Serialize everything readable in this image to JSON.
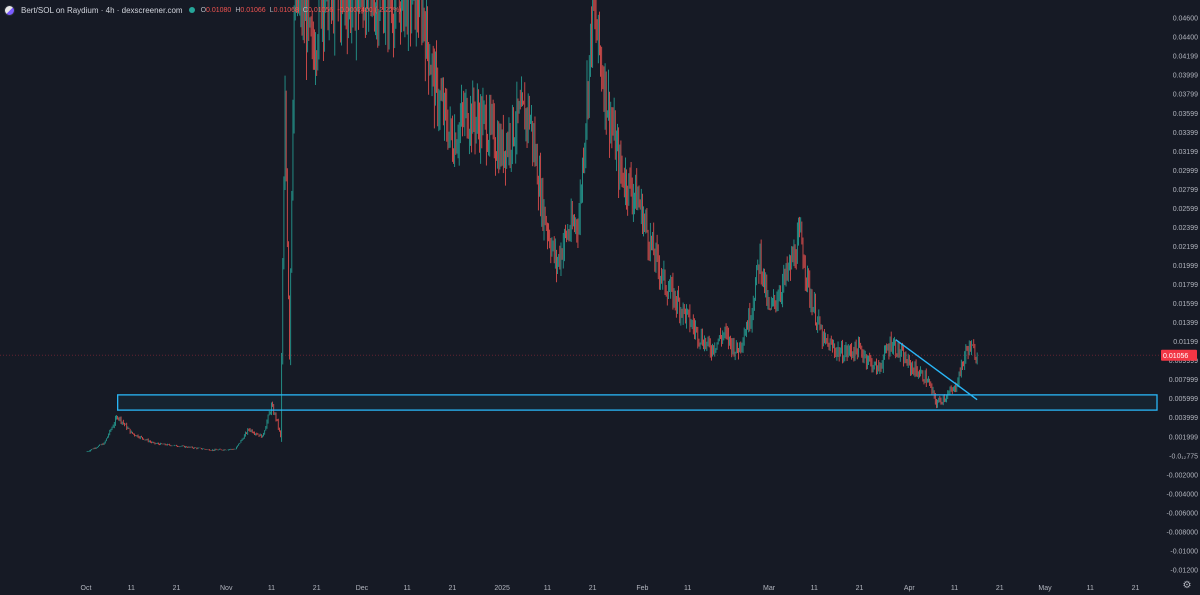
{
  "legend": {
    "title": "Bert/SOL on Raydium · 4h · dexscreener.com",
    "o_label": "O",
    "o_value": "0.01080",
    "h_label": "H",
    "h_value": "0.01066",
    "l_label": "L",
    "l_value": "0.01068",
    "c_label": "C",
    "c_value": "0.01056",
    "change": "-0.0002400 (-2.22%)"
  },
  "icons": {
    "pair": "bert-sol-pair-icon",
    "status": "live-dot-icon",
    "settings": "settings-gear-icon"
  },
  "colors": {
    "background": "#161a25",
    "up": "#26a69a",
    "down": "#ef5350",
    "drawing": "#29b6f6",
    "price_label": "#f23645"
  },
  "chart_data": {
    "type": "candlestick",
    "y_axis": {
      "min": -0.0125,
      "max": 0.0475,
      "ticks": [
        "0.04600",
        "0.04400",
        "0.04199",
        "0.03999",
        "0.03799",
        "0.03599",
        "0.03399",
        "0.03199",
        "0.02999",
        "0.02799",
        "0.02599",
        "0.02399",
        "0.02199",
        "0.01999",
        "0.01799",
        "0.01599",
        "0.01399",
        "0.01199",
        "0.009999",
        "0.007999",
        "0.005999",
        "0.003999",
        "0.001999",
        "-0.0₁₂775",
        "-0.002000",
        "-0.004000",
        "-0.006000",
        "-0.008000",
        "-0.01000",
        "-0.01200"
      ],
      "tick_values": [
        0.046,
        0.044,
        0.04199,
        0.03999,
        0.03799,
        0.03599,
        0.03399,
        0.03199,
        0.02999,
        0.02799,
        0.02599,
        0.02399,
        0.02199,
        0.01999,
        0.01799,
        0.01599,
        0.01399,
        0.01199,
        0.009999,
        0.007999,
        0.005999,
        0.003999,
        0.001999,
        0,
        -0.002,
        -0.004,
        -0.006,
        -0.008,
        -0.01,
        -0.012
      ]
    },
    "x_axis": {
      "start_date": "2024-10-01",
      "end_date": "2025-05-30",
      "ticks": [
        {
          "date": "2024-10-01",
          "label": "Oct"
        },
        {
          "date": "2024-10-11",
          "label": "11"
        },
        {
          "date": "2024-10-21",
          "label": "21"
        },
        {
          "date": "2024-11-01",
          "label": "Nov"
        },
        {
          "date": "2024-11-11",
          "label": "11"
        },
        {
          "date": "2024-11-21",
          "label": "21"
        },
        {
          "date": "2024-12-01",
          "label": "Dec"
        },
        {
          "date": "2024-12-11",
          "label": "11"
        },
        {
          "date": "2024-12-21",
          "label": "21"
        },
        {
          "date": "2025-01-01",
          "label": "2025"
        },
        {
          "date": "2025-01-11",
          "label": "11"
        },
        {
          "date": "2025-01-21",
          "label": "21"
        },
        {
          "date": "2025-02-01",
          "label": "Feb"
        },
        {
          "date": "2025-02-11",
          "label": "11"
        },
        {
          "date": "2025-03-01",
          "label": "Mar"
        },
        {
          "date": "2025-03-11",
          "label": "11"
        },
        {
          "date": "2025-03-21",
          "label": "21"
        },
        {
          "date": "2025-04-01",
          "label": "Apr"
        },
        {
          "date": "2025-04-11",
          "label": "11"
        },
        {
          "date": "2025-04-21",
          "label": "21"
        },
        {
          "date": "2025-05-01",
          "label": "May"
        },
        {
          "date": "2025-05-11",
          "label": "11"
        },
        {
          "date": "2025-05-21",
          "label": "21"
        }
      ]
    },
    "price_path": [
      {
        "date": "2024-10-01",
        "close": 0.0004
      },
      {
        "date": "2024-10-05",
        "close": 0.0013
      },
      {
        "date": "2024-10-08",
        "close": 0.0042
      },
      {
        "date": "2024-10-11",
        "close": 0.0024
      },
      {
        "date": "2024-10-16",
        "close": 0.0013
      },
      {
        "date": "2024-10-22",
        "close": 0.001
      },
      {
        "date": "2024-10-29",
        "close": 0.0006
      },
      {
        "date": "2024-11-03",
        "close": 0.0007
      },
      {
        "date": "2024-11-06",
        "close": 0.0028
      },
      {
        "date": "2024-11-09",
        "close": 0.002
      },
      {
        "date": "2024-11-11",
        "close": 0.0052
      },
      {
        "date": "2024-11-12",
        "close": 0.004
      },
      {
        "date": "2024-11-13",
        "close": 0.002
      },
      {
        "date": "2024-11-14",
        "close": 0.036
      },
      {
        "date": "2024-11-15",
        "close": 0.011
      },
      {
        "date": "2024-11-16",
        "close": 0.047
      },
      {
        "date": "2024-11-18",
        "close": 0.047
      },
      {
        "date": "2024-11-20",
        "close": 0.042
      },
      {
        "date": "2024-11-22",
        "close": 0.048
      },
      {
        "date": "2024-12-14",
        "close": 0.048
      },
      {
        "date": "2024-12-17",
        "close": 0.039
      },
      {
        "date": "2024-12-21",
        "close": 0.033
      },
      {
        "date": "2024-12-24",
        "close": 0.036
      },
      {
        "date": "2024-12-28",
        "close": 0.035
      },
      {
        "date": "2025-01-01",
        "close": 0.032
      },
      {
        "date": "2025-01-04",
        "close": 0.035
      },
      {
        "date": "2025-01-07",
        "close": 0.036
      },
      {
        "date": "2025-01-10",
        "close": 0.026
      },
      {
        "date": "2025-01-13",
        "close": 0.02
      },
      {
        "date": "2025-01-15",
        "close": 0.023
      },
      {
        "date": "2025-01-18",
        "close": 0.025
      },
      {
        "date": "2025-01-21",
        "close": 0.047
      },
      {
        "date": "2025-01-24",
        "close": 0.038
      },
      {
        "date": "2025-01-27",
        "close": 0.03
      },
      {
        "date": "2025-01-31",
        "close": 0.027
      },
      {
        "date": "2025-02-03",
        "close": 0.022
      },
      {
        "date": "2025-02-06",
        "close": 0.018
      },
      {
        "date": "2025-02-09",
        "close": 0.016
      },
      {
        "date": "2025-02-13",
        "close": 0.013
      },
      {
        "date": "2025-02-16",
        "close": 0.0112
      },
      {
        "date": "2025-02-19",
        "close": 0.0128
      },
      {
        "date": "2025-02-22",
        "close": 0.011
      },
      {
        "date": "2025-02-25",
        "close": 0.015
      },
      {
        "date": "2025-02-27",
        "close": 0.021
      },
      {
        "date": "2025-03-01",
        "close": 0.015
      },
      {
        "date": "2025-03-05",
        "close": 0.019
      },
      {
        "date": "2025-03-08",
        "close": 0.023
      },
      {
        "date": "2025-03-10",
        "close": 0.017
      },
      {
        "date": "2025-03-13",
        "close": 0.012
      },
      {
        "date": "2025-03-17",
        "close": 0.0108
      },
      {
        "date": "2025-03-21",
        "close": 0.0112
      },
      {
        "date": "2025-03-25",
        "close": 0.009
      },
      {
        "date": "2025-03-28",
        "close": 0.012
      },
      {
        "date": "2025-04-01",
        "close": 0.0095
      },
      {
        "date": "2025-04-05",
        "close": 0.008
      },
      {
        "date": "2025-04-07",
        "close": 0.0055
      },
      {
        "date": "2025-04-11",
        "close": 0.007
      },
      {
        "date": "2025-04-14",
        "close": 0.0115
      },
      {
        "date": "2025-04-16",
        "close": 0.0106
      }
    ],
    "current_price": {
      "value": 0.01056,
      "label": "0.01056"
    },
    "drawings": {
      "support_zone": {
        "date_from": "2024-10-08",
        "date_to": "2025-05-31",
        "price_low": 0.0048,
        "price_high": 0.0064
      },
      "trend_line": {
        "date_from": "2025-03-29",
        "price_from": 0.0122,
        "date_to": "2025-04-16",
        "price_to": 0.0059
      }
    }
  }
}
